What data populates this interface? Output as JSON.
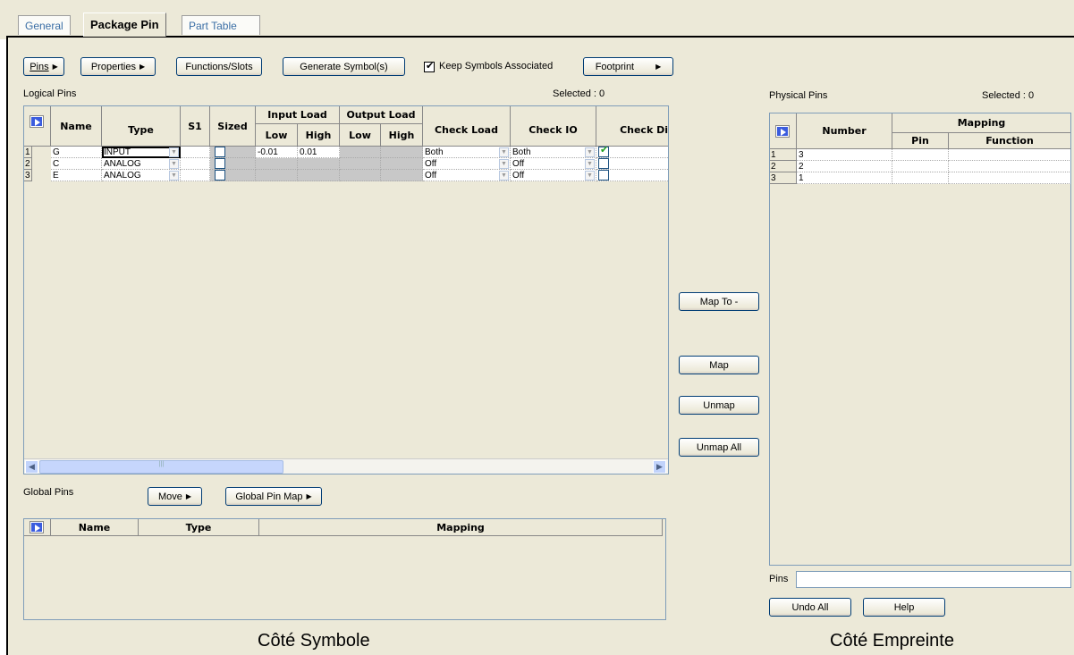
{
  "tabs": [
    "General",
    "Package Pin",
    "Part Table"
  ],
  "toolbar": {
    "pins": "Pins",
    "properties": "Properties",
    "functions": "Functions/Slots",
    "generate": "Generate Symbol(s)",
    "keep_label": "Keep Symbols Associated",
    "keep_checked": true,
    "footprint": "Footprint"
  },
  "logical": {
    "title": "Logical Pins",
    "selected": "Selected : 0",
    "headers": {
      "name": "Name",
      "type": "Type",
      "s1": "S1",
      "sized": "Sized",
      "input_load": "Input Load",
      "output_load": "Output Load",
      "low": "Low",
      "high": "High",
      "check_load": "Check Load",
      "check_io": "Check IO",
      "check_dir": "Check Di"
    },
    "rows": [
      {
        "num": "1",
        "name": "G",
        "type": "INPUT",
        "sized": false,
        "in_low": "-0.01",
        "in_high": "0.01",
        "check_load": "Both",
        "check_io": "Both",
        "check_dir": true
      },
      {
        "num": "2",
        "name": "C",
        "type": "ANALOG",
        "sized": false,
        "in_low": "",
        "in_high": "",
        "check_load": "Off",
        "check_io": "Off",
        "check_dir": false
      },
      {
        "num": "3",
        "name": "E",
        "type": "ANALOG",
        "sized": false,
        "in_low": "",
        "in_high": "",
        "check_load": "Off",
        "check_io": "Off",
        "check_dir": false
      }
    ]
  },
  "global": {
    "title": "Global Pins",
    "move": "Move",
    "map": "Global Pin Map",
    "headers": {
      "name": "Name",
      "type": "Type",
      "mapping": "Mapping"
    }
  },
  "middle": {
    "map_to": "Map To -",
    "map": "Map",
    "unmap": "Unmap",
    "unmap_all": "Unmap All"
  },
  "physical": {
    "title": "Physical Pins",
    "selected": "Selected : 0",
    "headers": {
      "number": "Number",
      "mapping": "Mapping",
      "pin": "Pin",
      "function": "Function"
    },
    "rows": [
      {
        "num": "1",
        "number": "3"
      },
      {
        "num": "2",
        "number": "2"
      },
      {
        "num": "3",
        "number": "1"
      }
    ],
    "pins_label": "Pins",
    "undo_all": "Undo All",
    "help": "Help"
  },
  "captions": {
    "left": "Côté Symbole",
    "right": "Côté Empreinte"
  }
}
